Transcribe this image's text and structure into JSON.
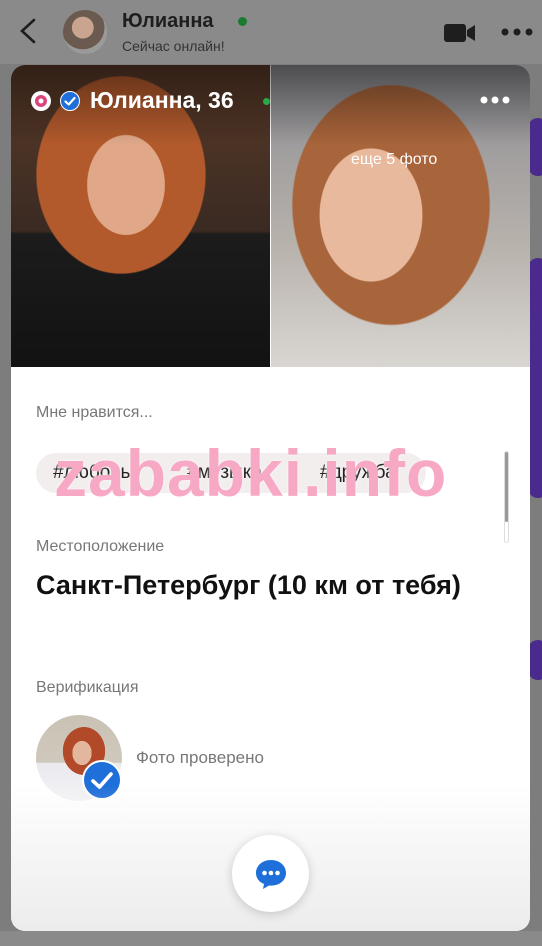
{
  "chat_header": {
    "name": "Юлианна",
    "status": "Сейчас онлайн!"
  },
  "card": {
    "title": "Юлианна, 36",
    "more_photos": "еще 5 фото",
    "likes_label": "Мне нравится...",
    "tags": [
      "#любовь",
      "#музыка",
      "#дружба"
    ],
    "location_label": "Местоположение",
    "location_value": "Санкт-Петербург (10 км от тебя)",
    "verification_label": "Верификация",
    "verification_text": "Фото проверено"
  },
  "watermark": "zababki.info",
  "colors": {
    "accent_blue": "#1e6fd9",
    "online_green": "#29a847",
    "watermark_pink": "#f7a8c4"
  }
}
